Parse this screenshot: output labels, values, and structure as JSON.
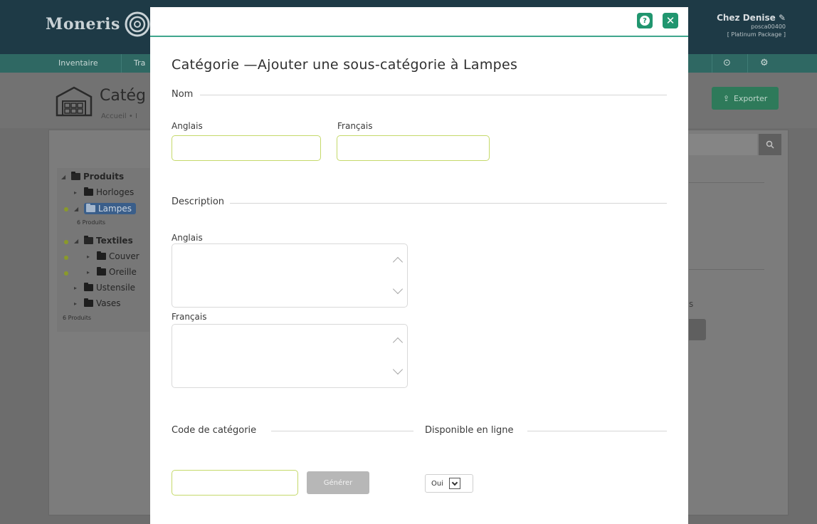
{
  "app": {
    "logo": "Moneris",
    "user": {
      "name": "Chez Denise",
      "id": "posca00400",
      "package": "[ Platinum Package ]"
    },
    "nav": [
      "Inventaire",
      "Tra"
    ],
    "page_title": "Catég",
    "breadcrumb": "Accueil  •  I",
    "export_label": "Exporter",
    "ghost_s": "s",
    "tree": [
      {
        "label": "Produits",
        "level": 0,
        "open": true,
        "bold": true
      },
      {
        "label": "Horloges",
        "level": 1
      },
      {
        "label": "Lampes",
        "level": 1,
        "selected": true,
        "open": true
      },
      {
        "label": "Textiles",
        "level": 1,
        "open": true,
        "bold": true
      },
      {
        "label": "Couver",
        "level": 2
      },
      {
        "label": "Oreille",
        "level": 2
      },
      {
        "label": "Ustensile",
        "level": 1
      },
      {
        "label": "Vases",
        "level": 1
      }
    ],
    "tree_counts": [
      "6 Produits",
      "6 Produits"
    ]
  },
  "modal": {
    "title": "Catégorie —Ajouter une sous-catégorie à Lampes",
    "sections": {
      "name": "Nom",
      "description": "Description",
      "code": "Code de catégorie",
      "online": "Disponible en ligne"
    },
    "labels": {
      "name_en": "Anglais",
      "name_fr": "Français",
      "desc_en": "Anglais",
      "desc_fr": "Français"
    },
    "fields": {
      "name_en": "",
      "name_fr": "",
      "desc_en": "",
      "desc_fr": "",
      "code": ""
    },
    "generate_label": "Générer",
    "online_value": "Oui"
  },
  "colors": {
    "accent": "#21966f",
    "input_border": "#c5d96a",
    "header": "#1e3a46",
    "nav": "#2f6863"
  }
}
